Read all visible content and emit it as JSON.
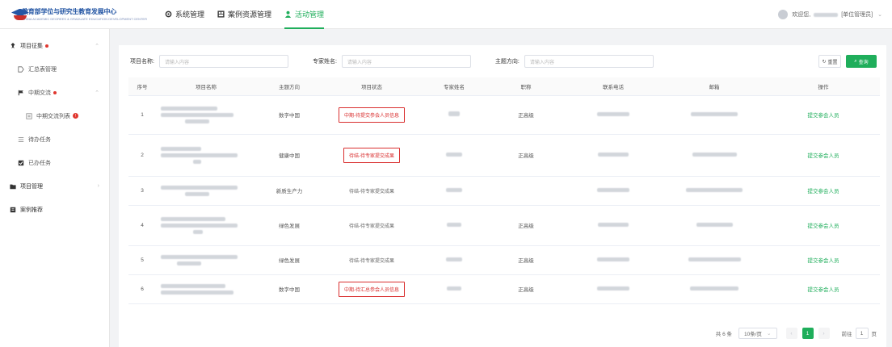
{
  "header": {
    "org_name": "教育部学位与研究生教育发展中心",
    "org_subtitle": "CHINA ACADEMIC DEGREES & GRADUATE EDUCATION DEVELOPMENT CENTER",
    "nav": [
      {
        "label": "系统管理",
        "icon": "gear-icon"
      },
      {
        "label": "案例资源管理",
        "icon": "grid-icon"
      },
      {
        "label": "活动管理",
        "icon": "person-icon",
        "active": true
      }
    ],
    "user_greeting": "欢迎您,",
    "user_role": "[单位管理员]",
    "accent": "#1fae5b"
  },
  "sidebar": {
    "items": [
      {
        "label": "项目征集",
        "level": 1,
        "icon": "pin-icon",
        "required": true
      },
      {
        "label": "汇总表管理",
        "level": 2,
        "icon": "tag-icon"
      },
      {
        "label": "中期交流",
        "level": 2,
        "icon": "flag-icon",
        "required": true
      },
      {
        "label": "中期交流列表",
        "level": 3,
        "icon": "list-icon",
        "badge": "!"
      },
      {
        "label": "待办任务",
        "level": 2,
        "icon": "todo-icon"
      },
      {
        "label": "已办任务",
        "level": 2,
        "icon": "done-icon"
      },
      {
        "label": "项目管理",
        "level": 1,
        "icon": "folder-icon"
      },
      {
        "label": "案例推荐",
        "level": 1,
        "icon": "book-icon"
      }
    ]
  },
  "filters": {
    "project_name_label": "项目名称:",
    "project_name_placeholder": "请输入内容",
    "expert_name_label": "专家姓名:",
    "expert_name_placeholder": "请输入内容",
    "theme_label": "主题方向:",
    "theme_placeholder": "请输入内容",
    "reset_label": "重置",
    "search_label": "查询"
  },
  "table": {
    "columns": [
      "序号",
      "项目名称",
      "主题方向",
      "项目状态",
      "专家姓名",
      "职称",
      "联系电话",
      "邮箱",
      "操作"
    ],
    "rows": [
      {
        "no": "1",
        "theme": "数字中国",
        "status": "中期-待提交参会人员信息",
        "highlight": true,
        "title": "正高级",
        "op": "提交参会人员"
      },
      {
        "no": "2",
        "theme": "健康中国",
        "status": "待结-待专家提交成果",
        "highlight": true,
        "title": "正高级",
        "op": "提交参会人员"
      },
      {
        "no": "3",
        "theme": "新质生产力",
        "status": "待结-待专家提交成果",
        "highlight": false,
        "title": "",
        "op": "提交参会人员"
      },
      {
        "no": "4",
        "theme": "绿色发展",
        "status": "待结-待专家提交成果",
        "highlight": false,
        "title": "正高级",
        "op": "提交参会人员"
      },
      {
        "no": "5",
        "theme": "绿色发展",
        "status": "待结-待专家提交成果",
        "highlight": false,
        "title": "正高级",
        "op": "提交参会人员"
      },
      {
        "no": "6",
        "theme": "数字中国",
        "status": "中期-待汇总参会人员信息",
        "highlight": true,
        "title": "正高级",
        "op": "提交参会人员"
      }
    ]
  },
  "pagination": {
    "total": "共 6 条",
    "page_size": "10条/页",
    "current": "1",
    "goto_label": "前往",
    "goto_value": "1",
    "page_suffix": "页"
  }
}
